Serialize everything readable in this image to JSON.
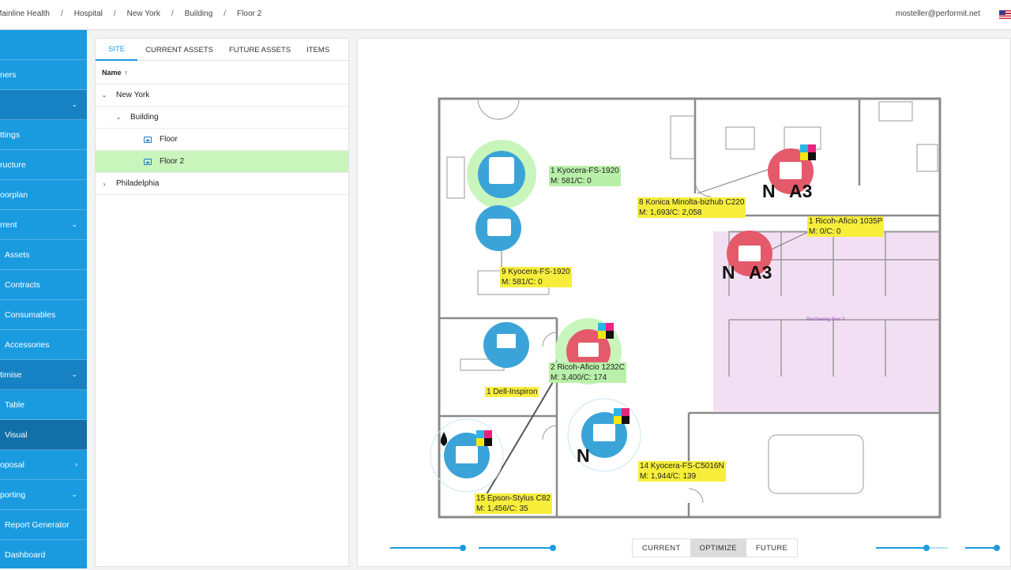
{
  "breadcrumb": [
    "Mainline Health",
    "Hospital",
    "New York",
    "Building",
    "Floor 2"
  ],
  "user": {
    "email": "mosteller@performit.net"
  },
  "sidebar": {
    "items": [
      {
        "label": "",
        "chevron": ""
      },
      {
        "label": "ners",
        "chevron": ""
      },
      {
        "label": "",
        "chevron": "⌄"
      },
      {
        "label": "ttings",
        "chevron": ""
      },
      {
        "label": "ructure",
        "chevron": ""
      },
      {
        "label": "oorplan",
        "chevron": ""
      },
      {
        "label": "rrent",
        "chevron": "⌄"
      },
      {
        "label": "Assets",
        "chevron": ""
      },
      {
        "label": "Contracts",
        "chevron": ""
      },
      {
        "label": "Consumables",
        "chevron": ""
      },
      {
        "label": "Accessories",
        "chevron": ""
      },
      {
        "label": "timise",
        "chevron": "⌄"
      },
      {
        "label": "Table",
        "chevron": ""
      },
      {
        "label": "Visual",
        "chevron": ""
      },
      {
        "label": "oposal",
        "chevron": "›"
      },
      {
        "label": "porting",
        "chevron": "⌄"
      },
      {
        "label": "Report Generator",
        "chevron": ""
      },
      {
        "label": "Dashboard",
        "chevron": ""
      }
    ]
  },
  "tabs": [
    {
      "label": "SITE",
      "active": true
    },
    {
      "label": "CURRENT ASSETS",
      "active": false
    },
    {
      "label": "FUTURE ASSETS",
      "active": false
    },
    {
      "label": "ITEMS",
      "active": false
    }
  ],
  "tree": {
    "header": "Name",
    "sort_icon": "↑",
    "rows": [
      {
        "label": "New York",
        "level": 0,
        "expander": "⌄",
        "icon": ""
      },
      {
        "label": "Building",
        "level": 1,
        "expander": "⌄",
        "icon": ""
      },
      {
        "label": "Floor",
        "level": 2,
        "expander": "",
        "icon": "image-icon"
      },
      {
        "label": "Floor 2",
        "level": 2,
        "expander": "",
        "icon": "image-icon",
        "selected": true
      },
      {
        "label": "Philadelphia",
        "level": 0,
        "expander": "›",
        "icon": ""
      }
    ]
  },
  "floorplan": {
    "zone_label": "Purchasing floor 2",
    "device_labels": [
      {
        "name": "1 Kyocera-FS-1920",
        "meta": "M: 581/C: 0",
        "style": "green"
      },
      {
        "name": "8 Konica Minolta-bizhub C220",
        "meta": "M: 1,693/C: 2,058",
        "style": "yellow"
      },
      {
        "name": "1 Ricoh-Aficio 1035P",
        "meta": "M: 0/C: 0",
        "style": "yellow"
      },
      {
        "name": "9 Kyocera-FS-1920",
        "meta": "M: 581/C: 0",
        "style": "yellow"
      },
      {
        "name": "2 Ricoh-Aficio 1232C",
        "meta": "M: 3,400/C: 174",
        "style": "green"
      },
      {
        "name": "1 Dell-Inspiron",
        "meta": "",
        "style": "yellow"
      },
      {
        "name": "14 Kyocera-FS-C5016N",
        "meta": "M: 1,944/C: 139",
        "style": "yellow"
      },
      {
        "name": "15 Epson-Stylus C82",
        "meta": "M: 1,456/C: 35",
        "style": "yellow"
      }
    ],
    "markers": [
      "N",
      "A3",
      "N",
      "A3",
      "N"
    ]
  },
  "modes": [
    {
      "label": "CURRENT",
      "active": false
    },
    {
      "label": "OPTIMIZE",
      "active": true
    },
    {
      "label": "FUTURE",
      "active": false
    }
  ],
  "colors": {
    "accent": "#1a9be0",
    "selected_row": "#c9f5bd",
    "red_device": "#e45a6a",
    "blue_device": "#3aa4d8",
    "zone": "#f3dff3"
  }
}
